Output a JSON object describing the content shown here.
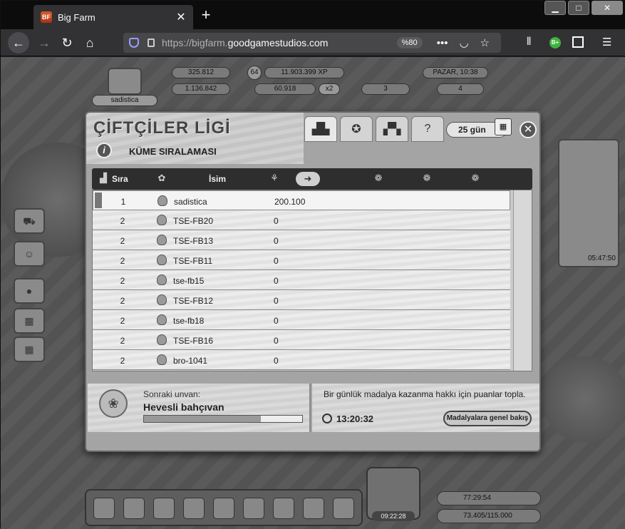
{
  "browser": {
    "tab_title": "Big Farm",
    "tab_favicon": "BF",
    "url_prefix": "https://bigfarm.",
    "url_domain": "goodgamestudios.com",
    "zoom": "%80",
    "extension_badge": "B+"
  },
  "hud": {
    "username": "sadistica",
    "coins": "325.812",
    "level": "64",
    "xp": "11.903.399 XP",
    "day_time": "PAZAR, 10:38",
    "cash": "1.136.842",
    "gold": "60.918",
    "multiplier": "x2",
    "workers": "3",
    "badge_count": "4"
  },
  "dialog": {
    "title": "ÇİFTÇİLER LİGİ",
    "subtitle": "KÜME SIRALAMASI",
    "days_left": "25 gün",
    "columns": {
      "rank": "Sıra",
      "name": "İsim"
    },
    "rows": [
      {
        "rank": "1",
        "name": "sadistica",
        "points": "200.100"
      },
      {
        "rank": "2",
        "name": "TSE-FB20",
        "points": "0"
      },
      {
        "rank": "2",
        "name": "TSE-FB13",
        "points": "0"
      },
      {
        "rank": "2",
        "name": "TSE-FB11",
        "points": "0"
      },
      {
        "rank": "2",
        "name": "tse-fb15",
        "points": "0"
      },
      {
        "rank": "2",
        "name": "TSE-FB12",
        "points": "0"
      },
      {
        "rank": "2",
        "name": "tse-fb18",
        "points": "0"
      },
      {
        "rank": "2",
        "name": "TSE-FB16",
        "points": "0"
      },
      {
        "rank": "2",
        "name": "bro-1041",
        "points": "0"
      }
    ],
    "next_title_label": "Sonraki unvan:",
    "next_title": "Hevesli bahçıvan",
    "next_title_progress": 0.74,
    "medal_text": "Bir günlük madalya kazanma hakkı için puanlar topla.",
    "timer": "13:20:32",
    "overview_button": "Madalyalara genel bakış"
  },
  "bottom": {
    "farm_timer": "09:22:28",
    "timer2": "77:29:54",
    "storage": "73.405/115.000",
    "quest_timer": "05:47:50"
  }
}
